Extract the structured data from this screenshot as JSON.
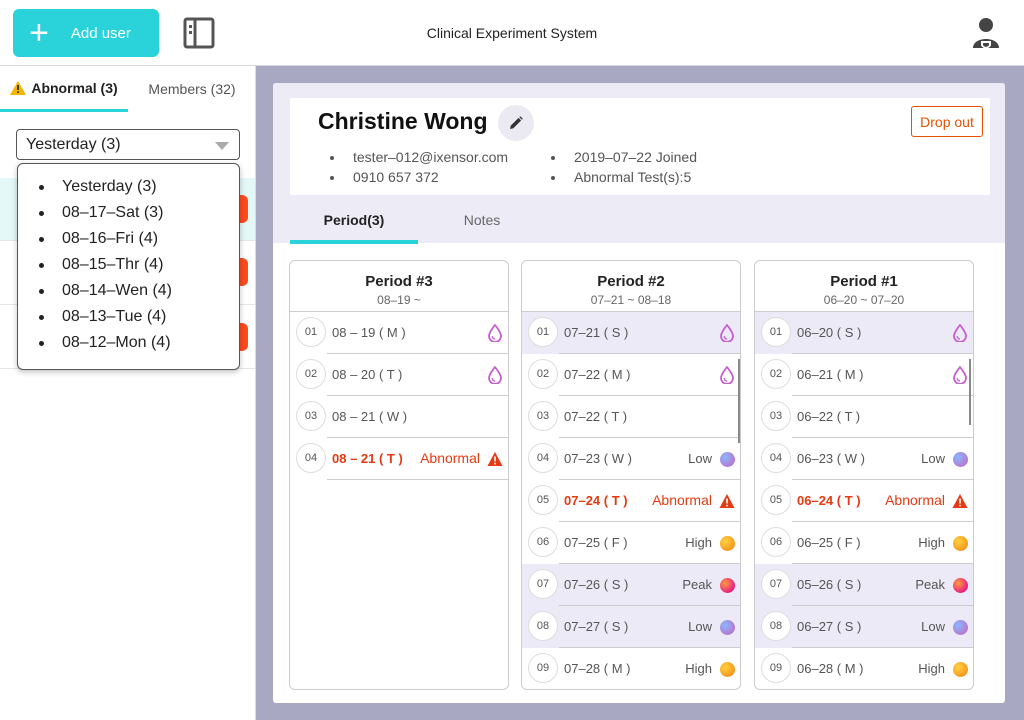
{
  "header": {
    "add_user_label": "Add user",
    "title": "Clinical Experiment System",
    "icons": [
      "plus-icon",
      "side-panel-icon",
      "user-avatar-icon"
    ]
  },
  "sidebar": {
    "tabs": [
      {
        "label": "Abnormal (3)",
        "active": true
      },
      {
        "label": "Members (32)",
        "active": false
      }
    ],
    "filter": {
      "selected": "Yesterday (3)",
      "options": [
        "Yesterday (3)",
        "08–17–Sat (3)",
        "08–16–Fri (4)",
        "08–15–Thr (4)",
        "08–14–Wen (4)",
        "08–13–Tue (4)",
        "08–12–Mon (4)"
      ]
    }
  },
  "patient": {
    "name": "Christine Wong",
    "email": "tester–012@ixensor.com",
    "phone": "0910 657 372",
    "joined": "2019–07–22 Joined",
    "abnormal_tests": "Abnormal Test(s):5",
    "drop_out_label": "Drop out"
  },
  "detail_tabs": [
    {
      "label": "Period(3)",
      "active": true
    },
    {
      "label": "Notes",
      "active": false
    }
  ],
  "colors": {
    "accent": "#2ad3d9",
    "abnormal": "#e53a12",
    "selected_row": "#ebeaf6",
    "drop_icon": "#c65fd1"
  },
  "periods": [
    {
      "title": "Period #3",
      "range": "08–19 ~",
      "entries": [
        {
          "num": "01",
          "date": "08 – 19 ( M )",
          "status": "",
          "icon": "drop",
          "selected": false,
          "abnormal": false
        },
        {
          "num": "02",
          "date": "08 – 20 ( T )",
          "status": "",
          "icon": "drop",
          "selected": false,
          "abnormal": false
        },
        {
          "num": "03",
          "date": "08 – 21 ( W )",
          "status": "",
          "icon": "",
          "selected": false,
          "abnormal": false
        },
        {
          "num": "04",
          "date": "08 – 21 ( T )",
          "status": "Abnormal",
          "icon": "warning",
          "selected": false,
          "abnormal": true
        }
      ]
    },
    {
      "title": "Period #2",
      "range": "07–21 ~ 08–18",
      "entries": [
        {
          "num": "01",
          "date": "07–21 ( S )",
          "status": "",
          "icon": "drop",
          "selected": true,
          "abnormal": false
        },
        {
          "num": "02",
          "date": "07–22 ( M )",
          "status": "",
          "icon": "drop",
          "selected": false,
          "abnormal": false
        },
        {
          "num": "03",
          "date": "07–22 ( T )",
          "status": "",
          "icon": "",
          "selected": false,
          "abnormal": false
        },
        {
          "num": "04",
          "date": "07–23 ( W )",
          "status": "Low",
          "icon": "low",
          "selected": false,
          "abnormal": false
        },
        {
          "num": "05",
          "date": "07–24 ( T )",
          "status": "Abnormal",
          "icon": "warning",
          "selected": false,
          "abnormal": true
        },
        {
          "num": "06",
          "date": "07–25 ( F )",
          "status": "High",
          "icon": "high",
          "selected": false,
          "abnormal": false
        },
        {
          "num": "07",
          "date": "07–26 ( S )",
          "status": "Peak",
          "icon": "peak",
          "selected": true,
          "abnormal": false
        },
        {
          "num": "08",
          "date": "07–27 ( S )",
          "status": "Low",
          "icon": "low",
          "selected": true,
          "abnormal": false
        },
        {
          "num": "09",
          "date": "07–28 ( M )",
          "status": "High",
          "icon": "high",
          "selected": false,
          "abnormal": false
        }
      ]
    },
    {
      "title": "Period #1",
      "range": "06–20 ~ 07–20",
      "entries": [
        {
          "num": "01",
          "date": "06–20 ( S )",
          "status": "",
          "icon": "drop",
          "selected": true,
          "abnormal": false
        },
        {
          "num": "02",
          "date": "06–21 ( M )",
          "status": "",
          "icon": "drop",
          "selected": false,
          "abnormal": false
        },
        {
          "num": "03",
          "date": "06–22 ( T )",
          "status": "",
          "icon": "",
          "selected": false,
          "abnormal": false
        },
        {
          "num": "04",
          "date": "06–23 ( W )",
          "status": "Low",
          "icon": "low",
          "selected": false,
          "abnormal": false
        },
        {
          "num": "05",
          "date": "06–24 ( T )",
          "status": "Abnormal",
          "icon": "warning",
          "selected": false,
          "abnormal": true
        },
        {
          "num": "06",
          "date": "06–25 ( F )",
          "status": "High",
          "icon": "high",
          "selected": false,
          "abnormal": false
        },
        {
          "num": "07",
          "date": "05–26 ( S )",
          "status": "Peak",
          "icon": "peak",
          "selected": true,
          "abnormal": false
        },
        {
          "num": "08",
          "date": "06–27 ( S )",
          "status": "Low",
          "icon": "low",
          "selected": true,
          "abnormal": false
        },
        {
          "num": "09",
          "date": "06–28 ( M )",
          "status": "High",
          "icon": "high",
          "selected": false,
          "abnormal": false
        }
      ]
    }
  ]
}
